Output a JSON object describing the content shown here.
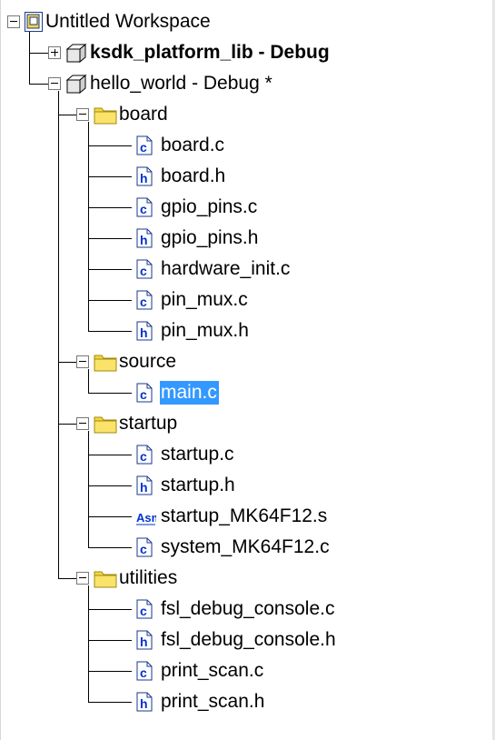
{
  "workspace": {
    "title": "Untitled Workspace",
    "projects": [
      {
        "name": "ksdk_platform_lib - Debug",
        "expanded": false,
        "bold": true
      },
      {
        "name": "hello_world - Debug *",
        "expanded": true,
        "bold": false
      }
    ]
  },
  "groups": [
    {
      "name": "board",
      "files": [
        {
          "name": "board.c",
          "type": "c"
        },
        {
          "name": "board.h",
          "type": "h"
        },
        {
          "name": "gpio_pins.c",
          "type": "c"
        },
        {
          "name": "gpio_pins.h",
          "type": "h"
        },
        {
          "name": "hardware_init.c",
          "type": "c"
        },
        {
          "name": "pin_mux.c",
          "type": "c"
        },
        {
          "name": "pin_mux.h",
          "type": "h"
        }
      ]
    },
    {
      "name": "source",
      "files": [
        {
          "name": "main.c",
          "type": "c",
          "selected": true
        }
      ]
    },
    {
      "name": "startup",
      "files": [
        {
          "name": "startup.c",
          "type": "c"
        },
        {
          "name": "startup.h",
          "type": "h"
        },
        {
          "name": "startup_MK64F12.s",
          "type": "asm"
        },
        {
          "name": "system_MK64F12.c",
          "type": "c"
        }
      ]
    },
    {
      "name": "utilities",
      "files": [
        {
          "name": "fsl_debug_console.c",
          "type": "c"
        },
        {
          "name": "fsl_debug_console.h",
          "type": "h"
        },
        {
          "name": "print_scan.c",
          "type": "c"
        },
        {
          "name": "print_scan.h",
          "type": "h"
        }
      ]
    }
  ],
  "icon_glyphs": {
    "c": "c",
    "h": "h",
    "asm": "Asm"
  },
  "colors": {
    "selection": "#3399ff",
    "folder": "#f5d542",
    "file_letter": "#0033cc"
  }
}
